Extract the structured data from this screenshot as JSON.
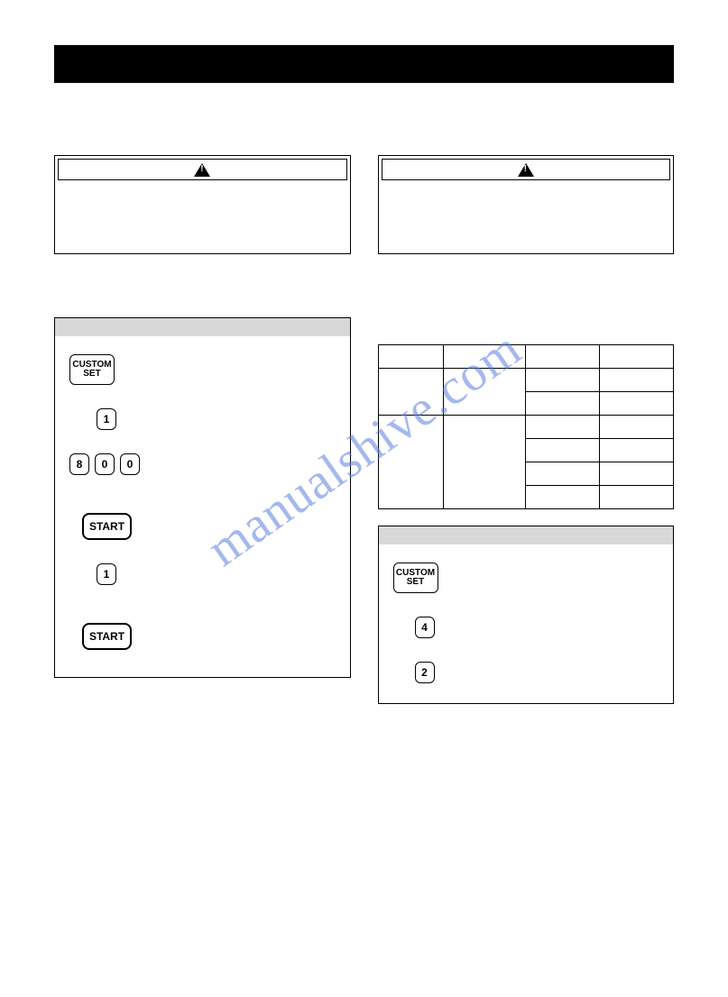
{
  "watermark": "manualshive.com",
  "buttons": {
    "custom_set": "CUSTOM\nSET",
    "start": "START",
    "d1": "1",
    "d8": "8",
    "d0": "0",
    "d4": "4",
    "d2": "2"
  }
}
